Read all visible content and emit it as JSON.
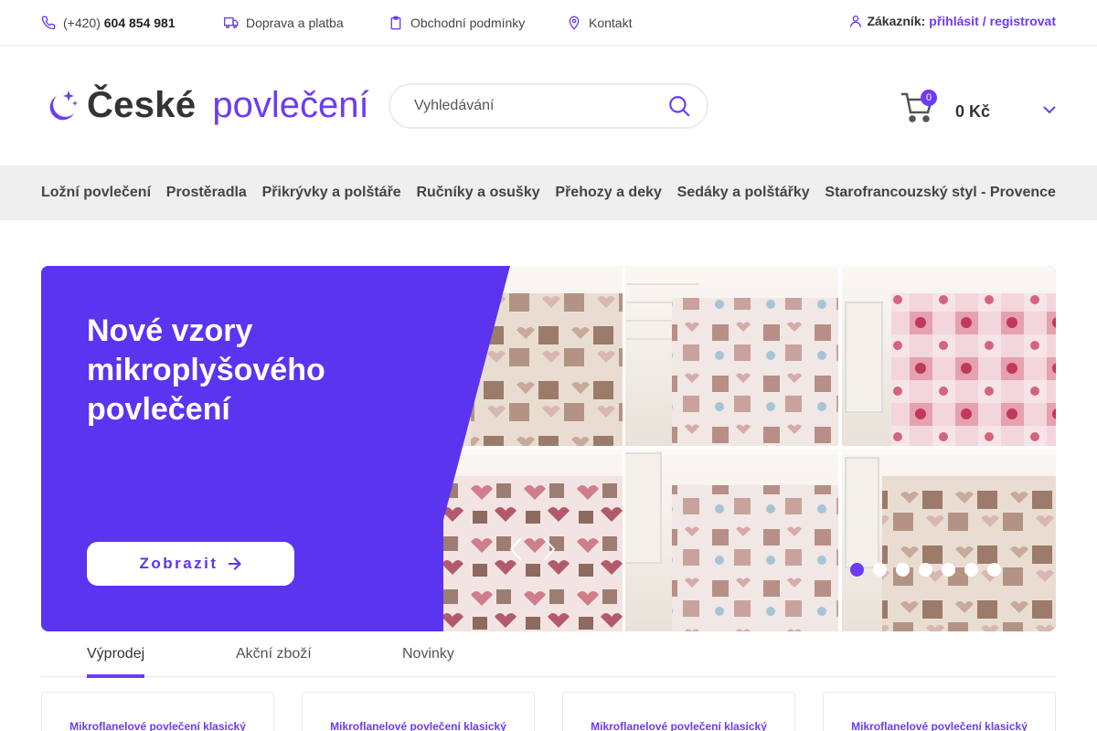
{
  "topbar": {
    "phone_prefix": "(+420)",
    "phone_number": "604 854 981",
    "shipping": "Doprava a platba",
    "terms": "Obchodní podmínky",
    "contact": "Kontakt",
    "customer_label": "Zákazník:",
    "login": "přihlásit",
    "separator": "/",
    "register": "registrovat"
  },
  "header": {
    "logo_part1": "České",
    "logo_part2": "povlečení",
    "search_placeholder": "Vyhledávání",
    "cart_count": "0",
    "cart_total": "0 Kč"
  },
  "nav": {
    "items": [
      "Ložní povlečení",
      "Prostěradla",
      "Přikrývky a polštáře",
      "Ručníky a osušky",
      "Přehozy a deky",
      "Sedáky a polštářky",
      "Starofrancouzský styl - Provence"
    ]
  },
  "hero": {
    "title": "Nové vzory mikroplyšového povlečení",
    "cta": "Zobrazit",
    "slides_count": 7,
    "active_slide": 1
  },
  "tabs": {
    "items": [
      "Výprodej",
      "Akční zboží",
      "Novinky"
    ],
    "active": 0
  },
  "products": [
    {
      "title": "Mikroflanelové povlečení klasický"
    },
    {
      "title": "Mikroflanelové povlečení klasický"
    },
    {
      "title": "Mikroflanelové povlečení klasický"
    },
    {
      "title": "Mikroflanelové povlečení klasický"
    }
  ],
  "colors": {
    "accent": "#6b3cf5",
    "hero_bg": "#5b34ef",
    "nav_bg": "#efefef"
  }
}
